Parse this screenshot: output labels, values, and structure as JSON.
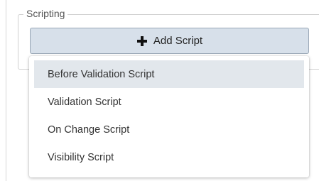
{
  "group": {
    "legend": "Scripting"
  },
  "add_button": {
    "label": "Add Script",
    "icon": "plus-icon"
  },
  "menu": {
    "items": [
      {
        "label": "Before Validation Script",
        "highlighted": true
      },
      {
        "label": "Validation Script",
        "highlighted": false
      },
      {
        "label": "On Change Script",
        "highlighted": false
      },
      {
        "label": "Visibility Script",
        "highlighted": false
      }
    ]
  },
  "colors": {
    "button_bg": "#d7e0ea",
    "highlight_bg": "#e2e7ec"
  }
}
